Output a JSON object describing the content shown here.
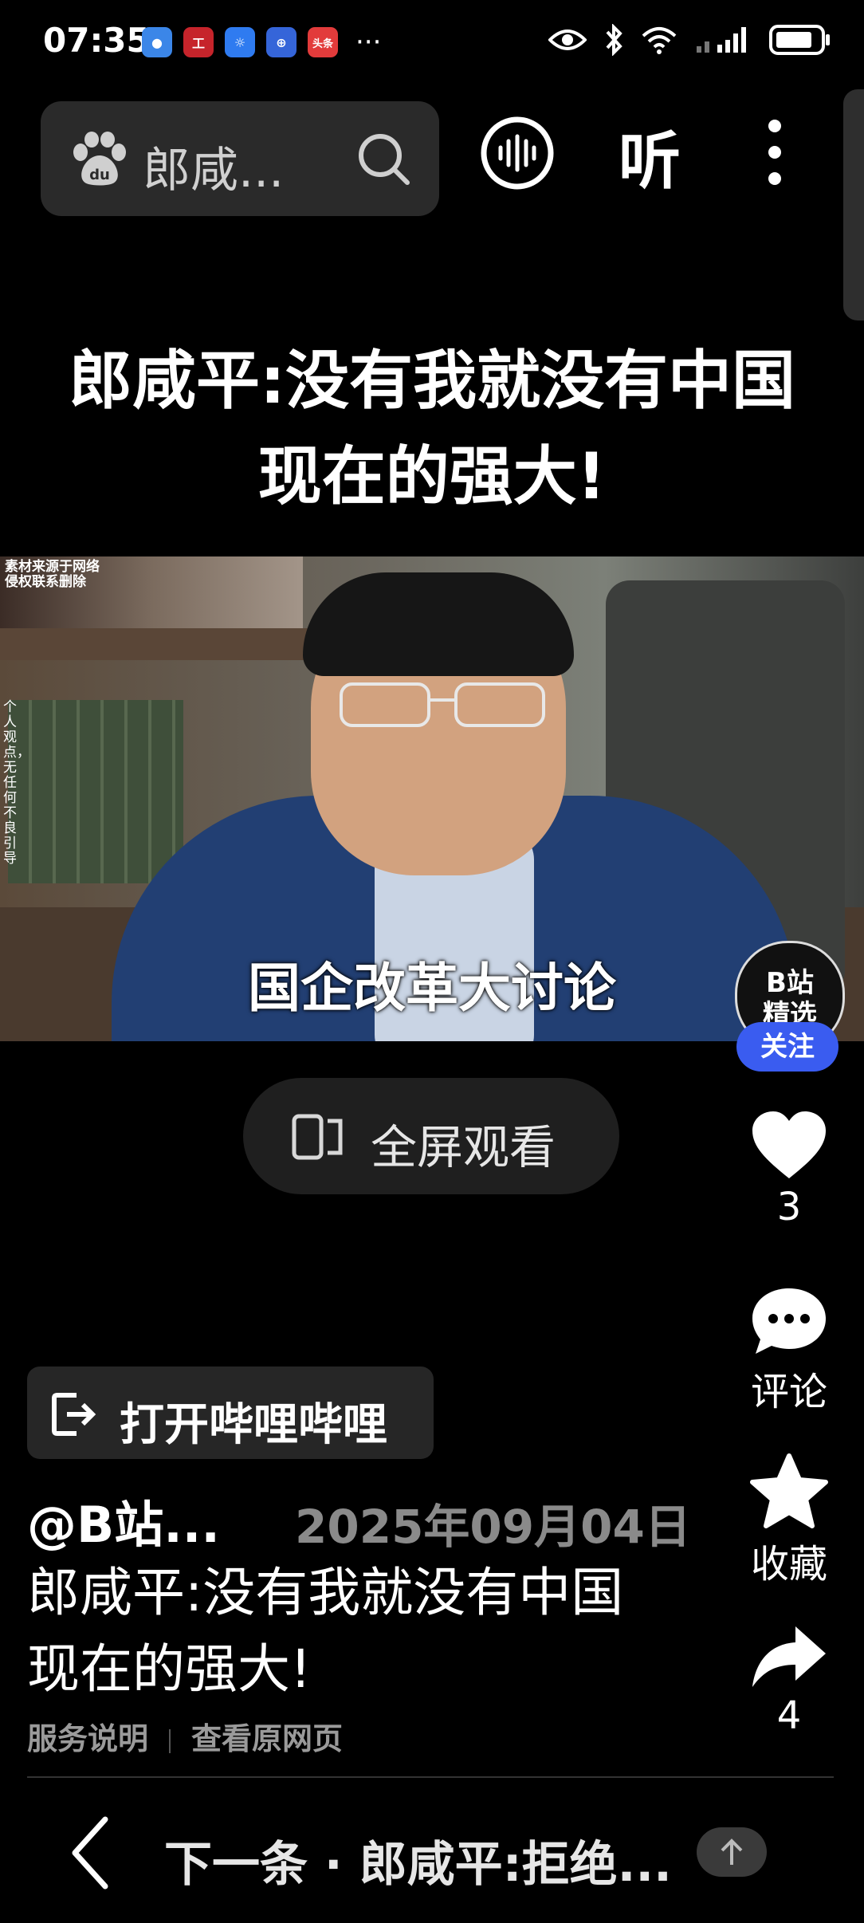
{
  "status_bar": {
    "time": "07:35",
    "notification_icons": [
      "blue-app-icon",
      "bank-icon",
      "bulb-app-icon",
      "globe-app-icon",
      "toutiao-icon"
    ],
    "notification_toutiao_label": "头条",
    "more_glyph": "···",
    "system_icons": [
      "eye-icon",
      "bluetooth-icon",
      "wifi-icon",
      "signal-icon",
      "battery-icon"
    ]
  },
  "header": {
    "search_query": "郎咸...",
    "search_icon": "search-icon",
    "logo_icon": "baidu-paw-icon",
    "sound_icon": "sound-wave-icon",
    "listen_label": "听",
    "more_icon": "more-vertical-icon"
  },
  "page_title_line1": "郎咸平:没有我就没有中国",
  "page_title_line2": "现在的强大!",
  "video": {
    "source_note_line1": "素材来源于网络",
    "source_note_line2": "侵权联系删除",
    "vertical_note": "个人观点，无任何不良引导",
    "subtitle": "国企改革大讨论",
    "badge_line1": "B站",
    "badge_line2": "精选",
    "follow_label": "关注"
  },
  "fullscreen_label": "全屏观看",
  "side_actions": {
    "like_count": "3",
    "comment_label": "评论",
    "favorite_label": "收藏",
    "share_count": "4"
  },
  "open_app_label": "打开哔哩哔哩",
  "author": "@B站...",
  "date": "2025年09月04日",
  "description_line1": "郎咸平:没有我就没有中国",
  "description_line2": "现在的强大!",
  "links": {
    "service": "服务说明",
    "original": "查看原网页"
  },
  "bottom": {
    "next_label": "下一条 · 郎咸平:拒绝..."
  },
  "colors": {
    "background": "#000000",
    "follow_button": "#3a5cf0",
    "date_text": "#8a8a8a"
  }
}
